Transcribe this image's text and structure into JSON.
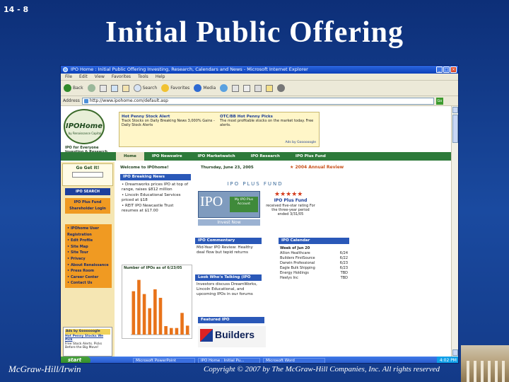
{
  "slide": {
    "number": "14 - 8",
    "title": "Initial Public Offering",
    "footer_left": "McGraw-Hill/Irwin",
    "footer_right": "Copyright © 2007 by The McGraw-Hill Companies, Inc. All rights reserved"
  },
  "browser": {
    "title": "IPO Home : Initial Public Offering Investing, Research, Calendars and News - Microsoft Internet Explorer",
    "menu": [
      "File",
      "Edit",
      "View",
      "Favorites",
      "Tools",
      "Help"
    ],
    "toolbar": {
      "back": "Back",
      "search": "Search",
      "favorites": "Favorites",
      "media": "Media"
    },
    "address_label": "Address",
    "address": "http://www.ipohome.com/default.asp",
    "go": "Go"
  },
  "page": {
    "logo": {
      "name": "IPOHome",
      "sub": "by Renaissance Capital"
    },
    "tagline": "IPO for Everyone Investing & Research",
    "ad": {
      "left_head": "Hot Penny Stock Alert",
      "left_text": "Track Stocks on Daily Breaking News 3,000% Gains - Daily Stock Alerts",
      "right_head": "OTC/BB Hot Penny Picks",
      "right_text": "The most profitable stocks on the market today. Free alerts.",
      "footer": "Ads by Goooooogle"
    },
    "nav": [
      "Home",
      "IPO Newswire",
      "IPO Marketwatch",
      "IPO Research",
      "IPO Plus Fund"
    ],
    "sidebar": {
      "goget": "Go Get It!",
      "ipo_search": "IPO SEARCH",
      "fund_login": "IPO Plus Fund Shareholder Login",
      "links": [
        "IPOhome User Registration",
        "Edit Profile",
        "Site Map",
        "Site Tour",
        "Privacy",
        "About Renaissance",
        "Press Room",
        "Career Center",
        "Contact Us"
      ],
      "ad_head": "Ads by Goooooogle",
      "ad_title": "Hot Penny Stocks We Pick",
      "ad_text": "Free Stock Alerts. Picks Before the Big Move!"
    },
    "welcome": "Welcome to IPOhome!",
    "date": "Thursday, June 23, 2005",
    "award": "2004 Annual Review",
    "breaking": {
      "head": "IPO Breaking News",
      "items": [
        "Dreamworks prices IPO at top of range, raises $812 million",
        "Lincoln Educational Services priced at $18",
        "REIT IPO Newcastle Trust resumes at $17.00"
      ]
    },
    "plus_fund": {
      "head": "IPO PLUS FUND",
      "stars": "★★★★★",
      "name": "IPO Plus Fund",
      "text": "received five-star rating For the three-year period ended 3/31/05",
      "account": "My IPO Plus Account",
      "invest": "Invest Now"
    },
    "commentary": {
      "head": "IPO Commentary",
      "text": "Mid-Year IPO Review: Healthy deal flow but tepid returns"
    },
    "calendar": {
      "head": "IPO Calendar",
      "week": "Week of Jun 20",
      "rows": [
        {
          "name": "Allion Healthcare",
          "date": "6/24"
        },
        {
          "name": "Builders FirstSource",
          "date": "6/22"
        },
        {
          "name": "Darwin Professional",
          "date": "6/23"
        },
        {
          "name": "Eagle Bulk Shipping",
          "date": "6/23"
        },
        {
          "name": "Energy Holdings",
          "date": "TBD"
        },
        {
          "name": "Heelys Inc",
          "date": "TBD"
        }
      ]
    },
    "talking": {
      "head": "Look Who's Talking (IPO Chat)",
      "text": "Investors discuss DreamWorks, Lincoln Educational, and upcoming IPOs in our forums"
    },
    "featured": {
      "head": "Featured IPO",
      "name": "Builders"
    },
    "chart": {
      "title": "Number of IPOs as of 6/23/05"
    }
  },
  "taskbar": {
    "start": "start",
    "tasks": [
      "Microsoft PowerPoint",
      "IPO Home : Initial Pu...",
      "Microsoft Word"
    ],
    "time": "4:02 PM"
  },
  "chart_data": {
    "type": "bar",
    "title": "Number of IPOs as of 6/23/05",
    "categories": [
      "1995",
      "1996",
      "1997",
      "1998",
      "1999",
      "2000",
      "2001",
      "2002",
      "2003",
      "2004",
      "2005"
    ],
    "values": [
      460,
      580,
      430,
      280,
      480,
      390,
      90,
      70,
      70,
      230,
      95
    ],
    "ylim": [
      0,
      600
    ],
    "colors": {
      "bar": "#e8731a"
    }
  }
}
